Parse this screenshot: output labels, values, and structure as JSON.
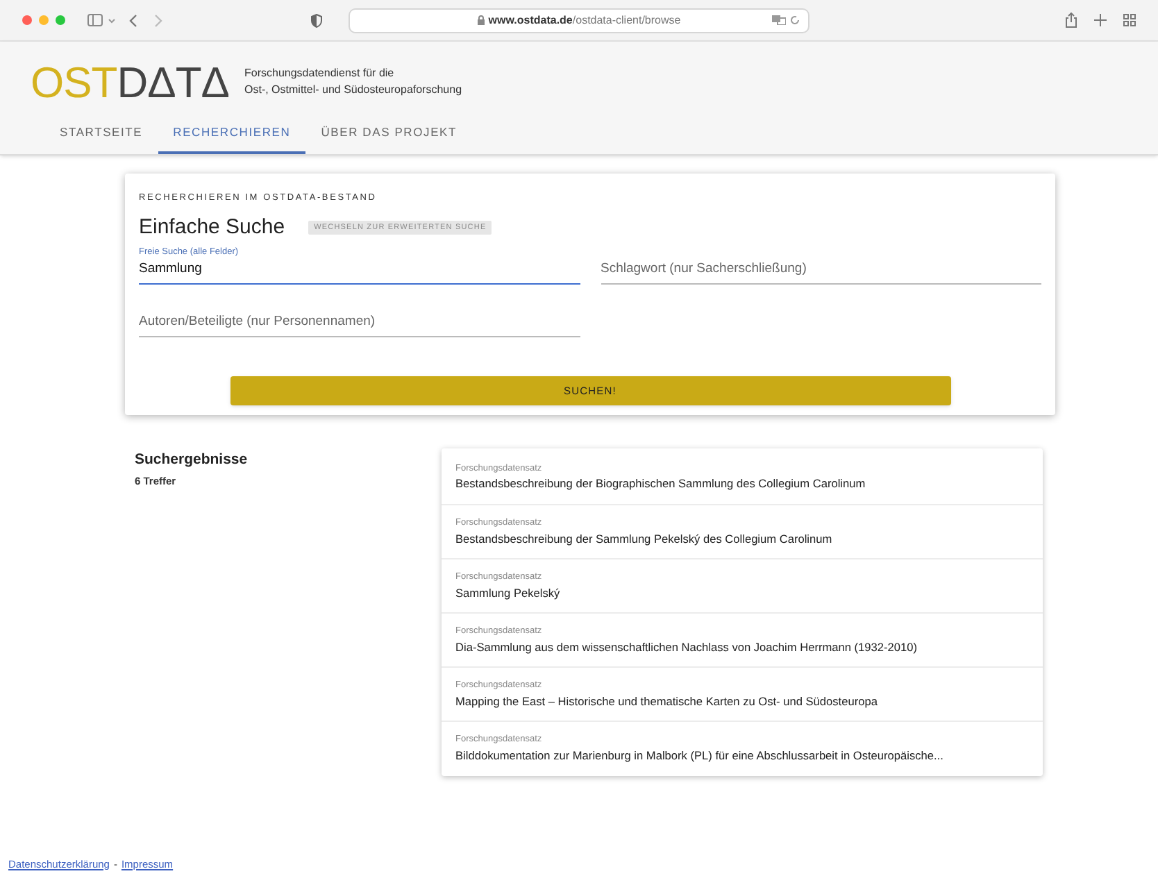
{
  "browser": {
    "url_domain": "www.ostdata.de",
    "url_path": "/ostdata-client/browse"
  },
  "header": {
    "logo_first": "OST",
    "logo_second": "DΔTΔ",
    "tagline_1": "Forschungsdatendienst für die",
    "tagline_2": "Ost-, Ostmittel- und Südosteuropaforschung"
  },
  "tabs": [
    {
      "label": "STARTSEITE",
      "selected": false
    },
    {
      "label": "RECHERCHIEREN",
      "selected": true
    },
    {
      "label": "ÜBER DAS PROJEKT",
      "selected": false
    }
  ],
  "search": {
    "overline": "RECHERCHIEREN IM OSTDATA-BESTAND",
    "title": "Einfache Suche",
    "switch_button": "WECHSELN ZUR ERWEITERTEN SUCHE",
    "fields": [
      {
        "label": "Freie Suche (alle Felder)",
        "value": "Sammlung",
        "focused": true
      },
      {
        "placeholder": "Schlagwort (nur Sacherschließung)",
        "focused": false
      },
      {
        "placeholder": "Autoren/Beteiligte (nur Personennamen)",
        "focused": false
      }
    ],
    "submit": "SUCHEN!"
  },
  "results": {
    "title": "Suchergebnisse",
    "count": "6 Treffer",
    "items": [
      {
        "type": "Forschungsdatensatz",
        "title": "Bestandsbeschreibung der Biographischen Sammlung des Collegium Carolinum"
      },
      {
        "type": "Forschungsdatensatz",
        "title": "Bestandsbeschreibung der Sammlung Pekelský des Collegium Carolinum"
      },
      {
        "type": "Forschungsdatensatz",
        "title": "Sammlung Pekelský"
      },
      {
        "type": "Forschungsdatensatz",
        "title": "Dia-Sammlung aus dem wissenschaftlichen Nachlass von Joachim Herrmann (1932-2010)"
      },
      {
        "type": "Forschungsdatensatz",
        "title": "Mapping the East – Historische und thematische Karten zu Ost- und Südosteuropa"
      },
      {
        "type": "Forschungsdatensatz",
        "title": "Bilddokumentation zur Marienburg in Malbork (PL) für eine Abschlussarbeit in Osteuropäische..."
      }
    ]
  },
  "footer": {
    "links": [
      "Datenschutzerklärung",
      "Impressum"
    ],
    "separator": "-"
  }
}
